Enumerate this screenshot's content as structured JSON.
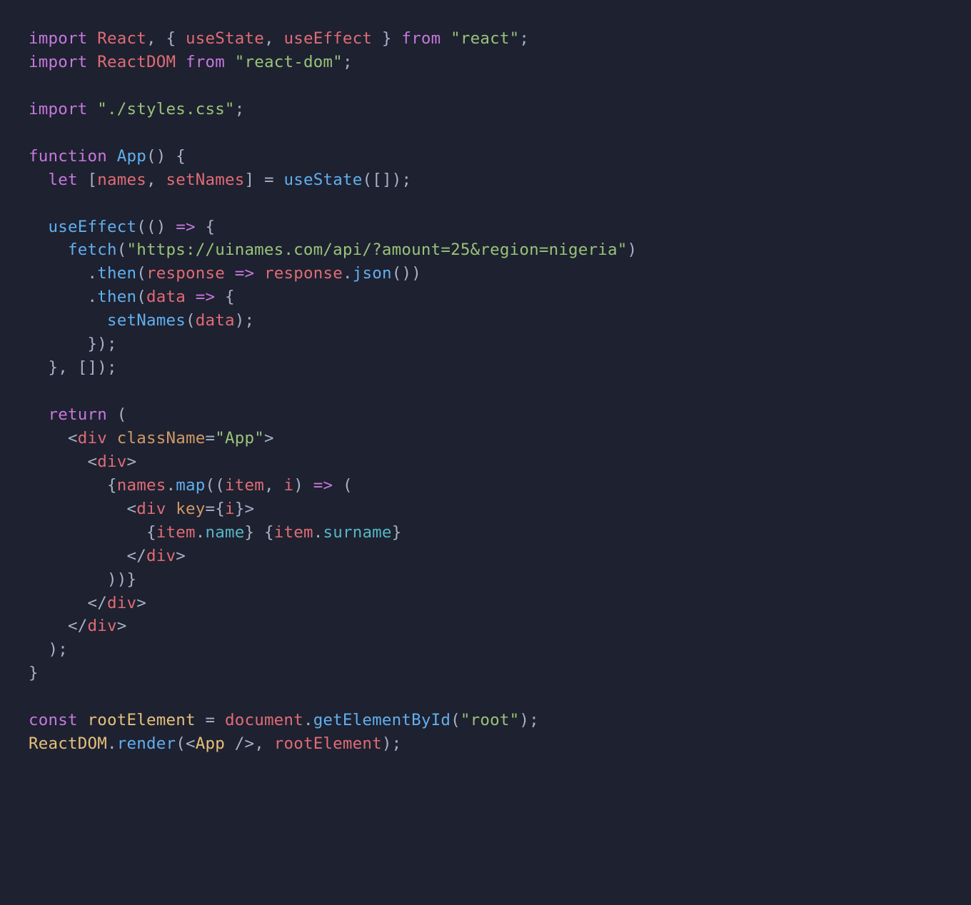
{
  "code": {
    "language": "jsx",
    "lines": [
      [
        {
          "t": "import",
          "c": "kw"
        },
        {
          "t": " ",
          "c": "punc"
        },
        {
          "t": "React",
          "c": "def"
        },
        {
          "t": ", { ",
          "c": "punc"
        },
        {
          "t": "useState",
          "c": "def"
        },
        {
          "t": ", ",
          "c": "punc"
        },
        {
          "t": "useEffect",
          "c": "def"
        },
        {
          "t": " } ",
          "c": "punc"
        },
        {
          "t": "from",
          "c": "kw"
        },
        {
          "t": " ",
          "c": "punc"
        },
        {
          "t": "\"react\"",
          "c": "str"
        },
        {
          "t": ";",
          "c": "punc"
        }
      ],
      [
        {
          "t": "import",
          "c": "kw"
        },
        {
          "t": " ",
          "c": "punc"
        },
        {
          "t": "ReactDOM",
          "c": "def"
        },
        {
          "t": " ",
          "c": "punc"
        },
        {
          "t": "from",
          "c": "kw"
        },
        {
          "t": " ",
          "c": "punc"
        },
        {
          "t": "\"react-dom\"",
          "c": "str"
        },
        {
          "t": ";",
          "c": "punc"
        }
      ],
      [],
      [
        {
          "t": "import",
          "c": "kw"
        },
        {
          "t": " ",
          "c": "punc"
        },
        {
          "t": "\"./styles.css\"",
          "c": "str"
        },
        {
          "t": ";",
          "c": "punc"
        }
      ],
      [],
      [
        {
          "t": "function",
          "c": "kw"
        },
        {
          "t": " ",
          "c": "punc"
        },
        {
          "t": "App",
          "c": "fn"
        },
        {
          "t": "() {",
          "c": "punc"
        }
      ],
      [
        {
          "t": "  ",
          "c": "punc"
        },
        {
          "t": "let",
          "c": "kw"
        },
        {
          "t": " [",
          "c": "punc"
        },
        {
          "t": "names",
          "c": "def"
        },
        {
          "t": ", ",
          "c": "punc"
        },
        {
          "t": "setNames",
          "c": "def"
        },
        {
          "t": "] = ",
          "c": "punc"
        },
        {
          "t": "useState",
          "c": "fn"
        },
        {
          "t": "([]);",
          "c": "punc"
        }
      ],
      [],
      [
        {
          "t": "  ",
          "c": "punc"
        },
        {
          "t": "useEffect",
          "c": "fn"
        },
        {
          "t": "(() ",
          "c": "punc"
        },
        {
          "t": "=>",
          "c": "kw"
        },
        {
          "t": " {",
          "c": "punc"
        }
      ],
      [
        {
          "t": "    ",
          "c": "punc"
        },
        {
          "t": "fetch",
          "c": "fn"
        },
        {
          "t": "(",
          "c": "punc"
        },
        {
          "t": "\"https://uinames.com/api/?amount=25&region=nigeria\"",
          "c": "str"
        },
        {
          "t": ")",
          "c": "punc"
        }
      ],
      [
        {
          "t": "      .",
          "c": "punc"
        },
        {
          "t": "then",
          "c": "fn"
        },
        {
          "t": "(",
          "c": "punc"
        },
        {
          "t": "response",
          "c": "param"
        },
        {
          "t": " ",
          "c": "punc"
        },
        {
          "t": "=>",
          "c": "kw"
        },
        {
          "t": " ",
          "c": "punc"
        },
        {
          "t": "response",
          "c": "var"
        },
        {
          "t": ".",
          "c": "punc"
        },
        {
          "t": "json",
          "c": "fn"
        },
        {
          "t": "())",
          "c": "punc"
        }
      ],
      [
        {
          "t": "      .",
          "c": "punc"
        },
        {
          "t": "then",
          "c": "fn"
        },
        {
          "t": "(",
          "c": "punc"
        },
        {
          "t": "data",
          "c": "param"
        },
        {
          "t": " ",
          "c": "punc"
        },
        {
          "t": "=>",
          "c": "kw"
        },
        {
          "t": " {",
          "c": "punc"
        }
      ],
      [
        {
          "t": "        ",
          "c": "punc"
        },
        {
          "t": "setNames",
          "c": "fn"
        },
        {
          "t": "(",
          "c": "punc"
        },
        {
          "t": "data",
          "c": "var"
        },
        {
          "t": ");",
          "c": "punc"
        }
      ],
      [
        {
          "t": "      });",
          "c": "punc"
        }
      ],
      [
        {
          "t": "  }, []);",
          "c": "punc"
        }
      ],
      [],
      [
        {
          "t": "  ",
          "c": "punc"
        },
        {
          "t": "return",
          "c": "kw"
        },
        {
          "t": " (",
          "c": "punc"
        }
      ],
      [
        {
          "t": "    <",
          "c": "punc"
        },
        {
          "t": "div",
          "c": "tag"
        },
        {
          "t": " ",
          "c": "punc"
        },
        {
          "t": "className",
          "c": "attr"
        },
        {
          "t": "=",
          "c": "punc"
        },
        {
          "t": "\"App\"",
          "c": "str"
        },
        {
          "t": ">",
          "c": "punc"
        }
      ],
      [
        {
          "t": "      <",
          "c": "punc"
        },
        {
          "t": "div",
          "c": "tag"
        },
        {
          "t": ">",
          "c": "punc"
        }
      ],
      [
        {
          "t": "        {",
          "c": "punc"
        },
        {
          "t": "names",
          "c": "var"
        },
        {
          "t": ".",
          "c": "punc"
        },
        {
          "t": "map",
          "c": "fn"
        },
        {
          "t": "((",
          "c": "punc"
        },
        {
          "t": "item",
          "c": "param"
        },
        {
          "t": ", ",
          "c": "punc"
        },
        {
          "t": "i",
          "c": "param"
        },
        {
          "t": ") ",
          "c": "punc"
        },
        {
          "t": "=>",
          "c": "kw"
        },
        {
          "t": " (",
          "c": "punc"
        }
      ],
      [
        {
          "t": "          <",
          "c": "punc"
        },
        {
          "t": "div",
          "c": "tag"
        },
        {
          "t": " ",
          "c": "punc"
        },
        {
          "t": "key",
          "c": "attr"
        },
        {
          "t": "={",
          "c": "punc"
        },
        {
          "t": "i",
          "c": "var"
        },
        {
          "t": "}>",
          "c": "punc"
        }
      ],
      [
        {
          "t": "            {",
          "c": "punc"
        },
        {
          "t": "item",
          "c": "var"
        },
        {
          "t": ".",
          "c": "punc"
        },
        {
          "t": "name",
          "c": "prop"
        },
        {
          "t": "} {",
          "c": "punc"
        },
        {
          "t": "item",
          "c": "var"
        },
        {
          "t": ".",
          "c": "punc"
        },
        {
          "t": "surname",
          "c": "prop"
        },
        {
          "t": "}",
          "c": "punc"
        }
      ],
      [
        {
          "t": "          </",
          "c": "punc"
        },
        {
          "t": "div",
          "c": "tag"
        },
        {
          "t": ">",
          "c": "punc"
        }
      ],
      [
        {
          "t": "        ))}",
          "c": "punc"
        }
      ],
      [
        {
          "t": "      </",
          "c": "punc"
        },
        {
          "t": "div",
          "c": "tag"
        },
        {
          "t": ">",
          "c": "punc"
        }
      ],
      [
        {
          "t": "    </",
          "c": "punc"
        },
        {
          "t": "div",
          "c": "tag"
        },
        {
          "t": ">",
          "c": "punc"
        }
      ],
      [
        {
          "t": "  );",
          "c": "punc"
        }
      ],
      [
        {
          "t": "}",
          "c": "punc"
        }
      ],
      [],
      [
        {
          "t": "const",
          "c": "kw"
        },
        {
          "t": " ",
          "c": "punc"
        },
        {
          "t": "rootElement",
          "c": "ident"
        },
        {
          "t": " = ",
          "c": "punc"
        },
        {
          "t": "document",
          "c": "var"
        },
        {
          "t": ".",
          "c": "punc"
        },
        {
          "t": "getElementById",
          "c": "fn"
        },
        {
          "t": "(",
          "c": "punc"
        },
        {
          "t": "\"root\"",
          "c": "str"
        },
        {
          "t": ");",
          "c": "punc"
        }
      ],
      [
        {
          "t": "ReactDOM",
          "c": "ident"
        },
        {
          "t": ".",
          "c": "punc"
        },
        {
          "t": "render",
          "c": "fn"
        },
        {
          "t": "(<",
          "c": "punc"
        },
        {
          "t": "App",
          "c": "ident"
        },
        {
          "t": " />, ",
          "c": "punc"
        },
        {
          "t": "rootElement",
          "c": "var"
        },
        {
          "t": ");",
          "c": "punc"
        }
      ]
    ]
  }
}
